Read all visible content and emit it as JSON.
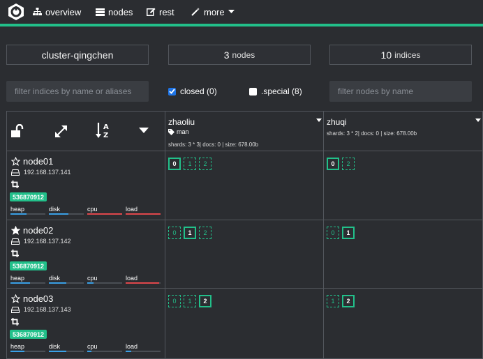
{
  "nav": {
    "items": [
      {
        "label": "overview",
        "icon": "sitemap-icon"
      },
      {
        "label": "nodes",
        "icon": "server-icon"
      },
      {
        "label": "rest",
        "icon": "edit-icon"
      },
      {
        "label": "more",
        "icon": "wand-icon"
      }
    ]
  },
  "colors": {
    "accent": "#22c08a",
    "checkbox": "#1e74e6",
    "heap": "#3aa0e6",
    "danger": "#e0474c"
  },
  "summary": {
    "cluster_name": "cluster-qingchen",
    "nodes_count": "3",
    "nodes_label": "nodes",
    "indices_count": "10",
    "indices_label": "indices"
  },
  "filters": {
    "indices_placeholder": "filter indices by name or aliases",
    "closed_label": "closed (0)",
    "closed_checked": true,
    "special_label": ".special (8)",
    "special_checked": false,
    "nodes_placeholder": "filter nodes by name"
  },
  "toolbar_icons": [
    "unlock-icon",
    "expand-icon",
    "sort-alpha-icon",
    "caret-down-icon"
  ],
  "indices": [
    {
      "name": "zhaoliu",
      "alias": "man",
      "stats": "shards: 3 * 3| docs: 0 | size: 678.00b"
    },
    {
      "name": "zhuqi",
      "alias": "",
      "stats": "shards: 3 * 2| docs: 0 | size: 678.00b"
    }
  ],
  "metric_labels": [
    "heap",
    "disk",
    "cpu",
    "load"
  ],
  "nodes": [
    {
      "name": "node01",
      "master": false,
      "ip": "192.168.137.141",
      "badge": "536870912",
      "metrics": [
        {
          "name": "heap",
          "fill": 0.45,
          "color": "#3aa0e6"
        },
        {
          "name": "disk",
          "fill": 0.55,
          "color": "#3aa0e6"
        },
        {
          "name": "cpu",
          "fill": 1.0,
          "color": "#e0474c"
        },
        {
          "name": "load",
          "fill": 1.0,
          "color": "#e0474c"
        }
      ],
      "shards": [
        [
          {
            "n": "0",
            "primary": true
          },
          {
            "n": "1",
            "primary": false
          },
          {
            "n": "2",
            "primary": false
          }
        ],
        [
          {
            "n": "0",
            "primary": true
          },
          {
            "n": "2",
            "primary": false
          }
        ]
      ]
    },
    {
      "name": "node02",
      "master": true,
      "ip": "192.168.137.142",
      "badge": "536870912",
      "metrics": [
        {
          "name": "heap",
          "fill": 0.55,
          "color": "#3aa0e6"
        },
        {
          "name": "disk",
          "fill": 0.5,
          "color": "#3aa0e6"
        },
        {
          "name": "cpu",
          "fill": 0.18,
          "color": "#3aa0e6"
        },
        {
          "name": "load",
          "fill": 0.95,
          "color": "#e0474c"
        }
      ],
      "shards": [
        [
          {
            "n": "0",
            "primary": false
          },
          {
            "n": "1",
            "primary": true
          },
          {
            "n": "2",
            "primary": false
          }
        ],
        [
          {
            "n": "0",
            "primary": false
          },
          {
            "n": "1",
            "primary": true
          }
        ]
      ]
    },
    {
      "name": "node03",
      "master": false,
      "ip": "192.168.137.143",
      "badge": "536870912",
      "metrics": [
        {
          "name": "heap",
          "fill": 0.4,
          "color": "#3aa0e6"
        },
        {
          "name": "disk",
          "fill": 0.5,
          "color": "#3aa0e6"
        },
        {
          "name": "cpu",
          "fill": 0.12,
          "color": "#3aa0e6"
        },
        {
          "name": "load",
          "fill": 0.15,
          "color": "#3aa0e6"
        }
      ],
      "shards": [
        [
          {
            "n": "0",
            "primary": false
          },
          {
            "n": "1",
            "primary": false
          },
          {
            "n": "2",
            "primary": true
          }
        ],
        [
          {
            "n": "1",
            "primary": false
          },
          {
            "n": "2",
            "primary": true
          }
        ]
      ]
    }
  ]
}
